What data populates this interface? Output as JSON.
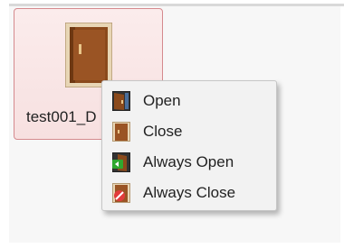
{
  "door": {
    "label": "test001_D",
    "icon": "door-icon"
  },
  "context_menu": {
    "items": [
      {
        "label": "Open",
        "icon": "door-open-icon"
      },
      {
        "label": "Close",
        "icon": "door-closed-icon"
      },
      {
        "label": "Always Open",
        "icon": "door-always-open-icon"
      },
      {
        "label": "Always Close",
        "icon": "door-always-close-icon"
      }
    ]
  },
  "colors": {
    "tile_border": "#d58a8e",
    "tile_background": "#fbecec",
    "door_brown": "#8b4a1c",
    "menu_background": "#f2f2f2"
  }
}
